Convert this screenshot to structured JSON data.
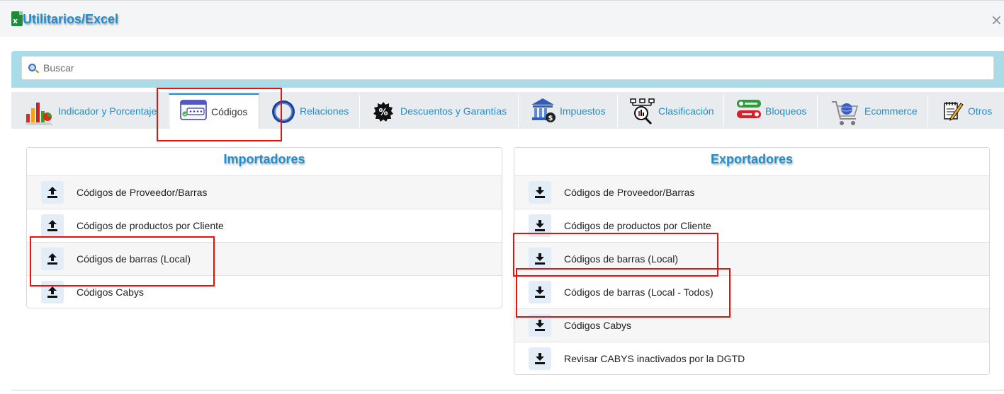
{
  "window": {
    "title": "Utilitarios/Excel",
    "close_glyph": "×"
  },
  "search": {
    "placeholder": "Buscar",
    "value": ""
  },
  "tabs": [
    {
      "label": "Indicador y Porcentaje",
      "icon": "bar-chart-icon"
    },
    {
      "label": "Códigos",
      "icon": "barcode-window-icon",
      "active": true
    },
    {
      "label": "Relaciones",
      "icon": "relations-icon"
    },
    {
      "label": "Descuentos y Garantías",
      "icon": "percent-badge-icon"
    },
    {
      "label": "Impuestos",
      "icon": "bank-tax-icon"
    },
    {
      "label": "Clasificación",
      "icon": "hierarchy-magnifier-icon"
    },
    {
      "label": "Bloqueos",
      "icon": "lock-unlock-icon"
    },
    {
      "label": "Ecommerce",
      "icon": "shopping-cart-icon"
    },
    {
      "label": "Otros",
      "icon": "pencil-notebook-icon"
    }
  ],
  "importers": {
    "title": "Importadores",
    "items": [
      {
        "label": "Códigos de Proveedor/Barras",
        "icon": "upload-icon"
      },
      {
        "label": "Códigos de productos por Cliente",
        "icon": "upload-icon"
      },
      {
        "label": "Códigos de barras (Local)",
        "icon": "upload-icon"
      },
      {
        "label": "Códigos Cabys",
        "icon": "upload-icon"
      }
    ]
  },
  "exporters": {
    "title": "Exportadores",
    "items": [
      {
        "label": "Códigos de Proveedor/Barras",
        "icon": "download-icon"
      },
      {
        "label": "Códigos de productos por Cliente",
        "icon": "download-icon"
      },
      {
        "label": "Códigos de barras (Local)",
        "icon": "download-icon"
      },
      {
        "label": "Códigos de barras (Local - Todos)",
        "icon": "download-icon"
      },
      {
        "label": "Códigos Cabys",
        "icon": "download-icon"
      },
      {
        "label": "Revisar CABYS inactivados por la DGTD",
        "icon": "download-icon"
      }
    ]
  },
  "colors": {
    "accent": "#1d8fd0",
    "search_band": "#a9dbe8",
    "highlight": "#e8120c",
    "tab_bar": "#e9ecee"
  }
}
